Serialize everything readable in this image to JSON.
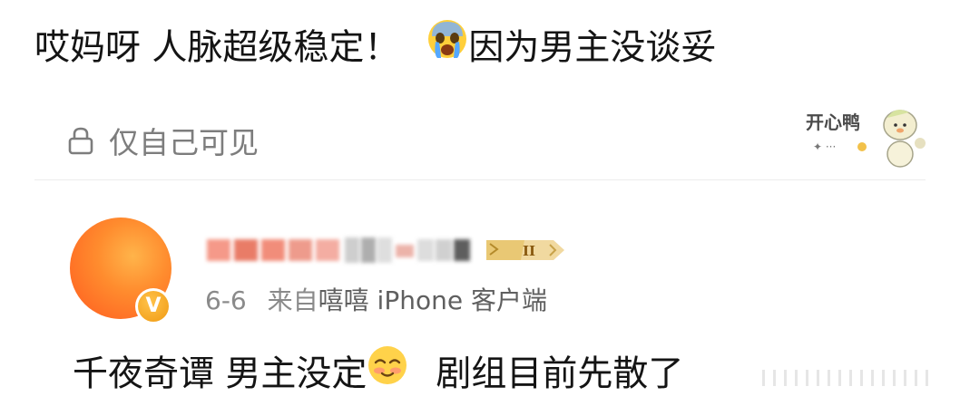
{
  "post1": {
    "text_a": "哎妈呀 人脉超级稳定！",
    "text_b": "因为男主没谈妥",
    "emoji": "crying-face-emoji"
  },
  "privacy": {
    "label": "仅自己可见",
    "icon": "lock-icon"
  },
  "sticker": {
    "text": "开心鸭",
    "icon": "happy-duck-sticker"
  },
  "user": {
    "avatar": "orange-avatar",
    "verified_badge": "V",
    "level_badge": "II"
  },
  "meta": {
    "date": "6-6",
    "source_prefix": "来自",
    "device": "嘻嘻 iPhone 客户端"
  },
  "post2": {
    "text_a": "千夜奇谭 男主没定",
    "text_b": "剧组目前先散了",
    "emoji": "smiling-blush-emoji"
  },
  "colors": {
    "text": "#141414",
    "muted": "#7d7d7d",
    "avatar": "#ff7a28",
    "badge": "#f0a21a"
  }
}
